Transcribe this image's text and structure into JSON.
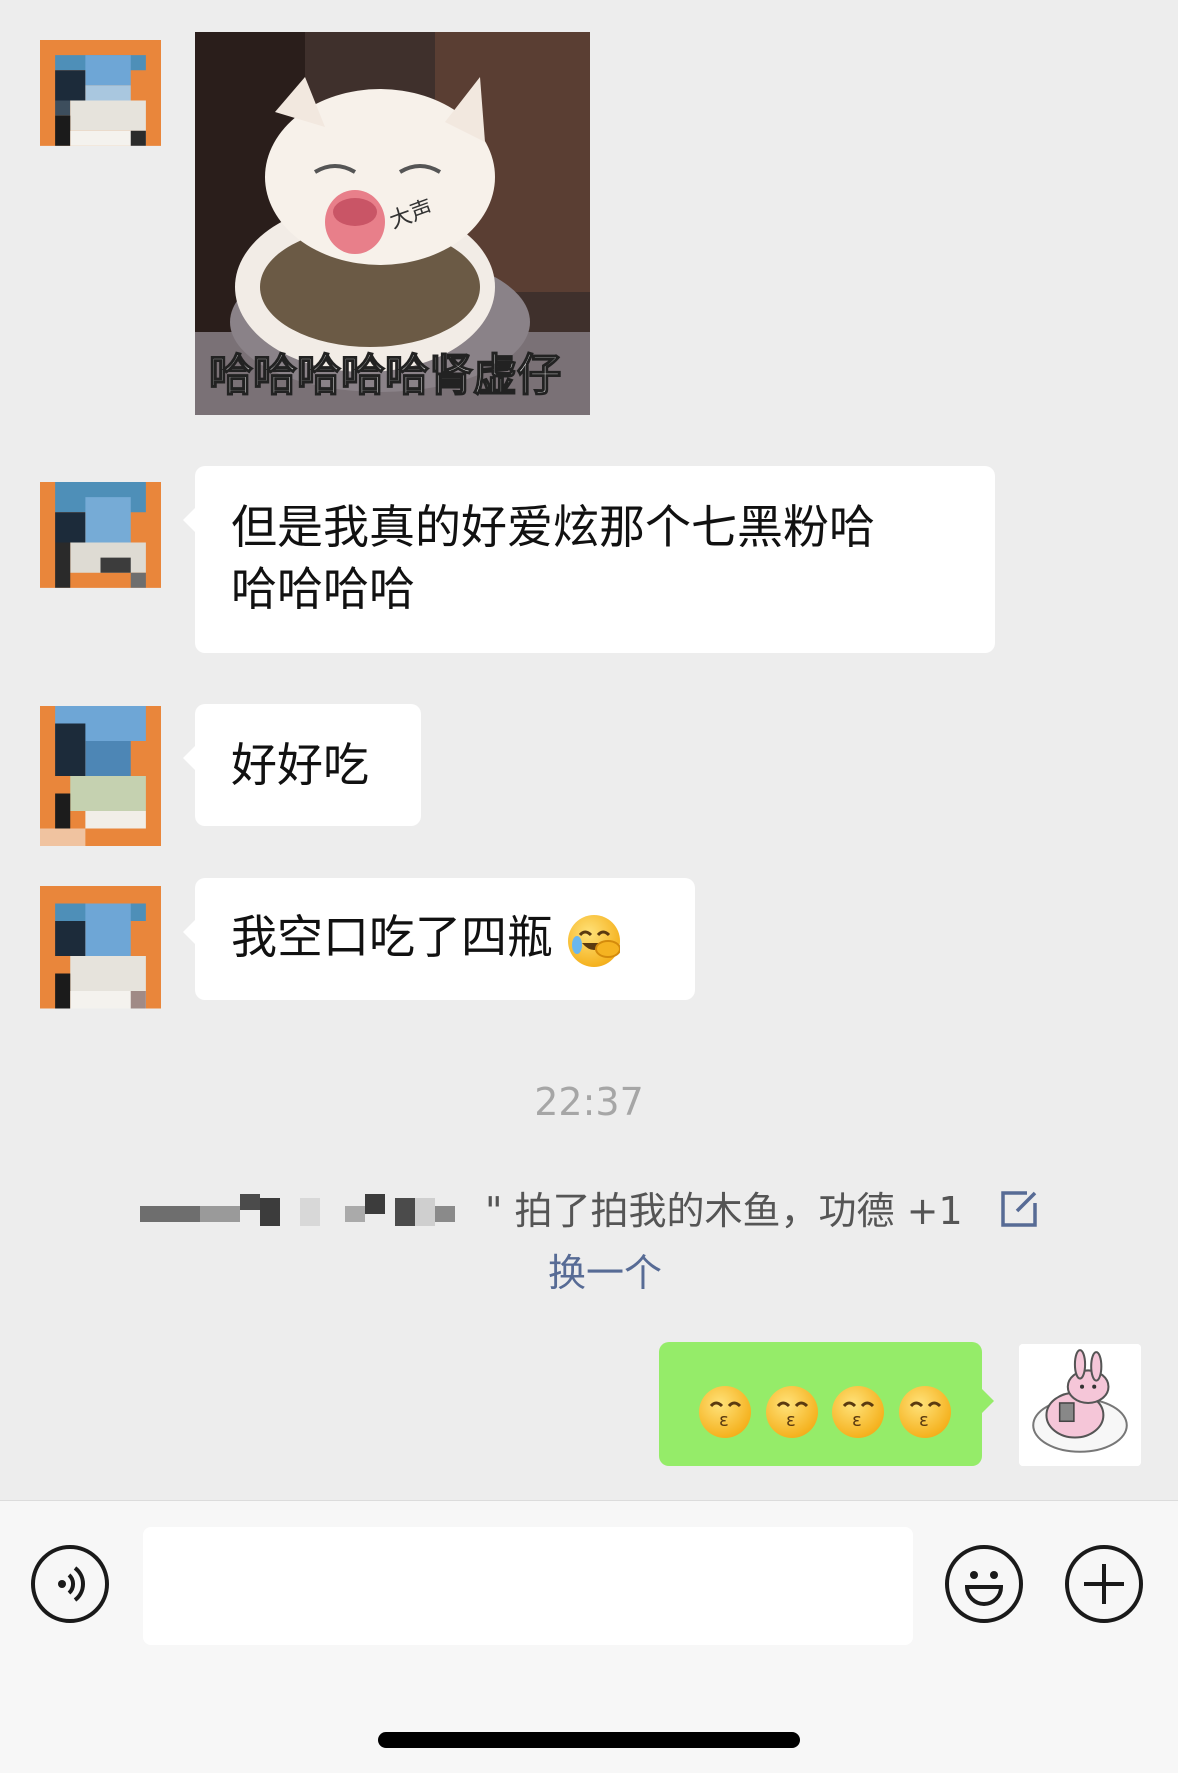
{
  "messages": [
    {
      "type": "image",
      "caption": "哈哈哈哈哈肾虚仔",
      "stamp": "大声"
    },
    {
      "type": "text",
      "line1": "但是我真的好爱炫那个七黑粉哈",
      "line2": "哈哈哈哈"
    },
    {
      "type": "text",
      "text": "好好吃"
    },
    {
      "type": "text",
      "text": "我空口吃了四瓶"
    }
  ],
  "timestamp": "22:37",
  "system_notice": {
    "text": "\" 拍了拍我的木鱼，功德 +1",
    "action": "换一个"
  },
  "my_message": {
    "emoji": "kissing-face",
    "count": 4
  },
  "colors": {
    "background": "#ededed",
    "my_bubble": "#95ec69",
    "link": "#576b95"
  },
  "bottom_bar": {
    "icons": [
      "voice-icon",
      "emoji-icon",
      "plus-icon"
    ]
  }
}
